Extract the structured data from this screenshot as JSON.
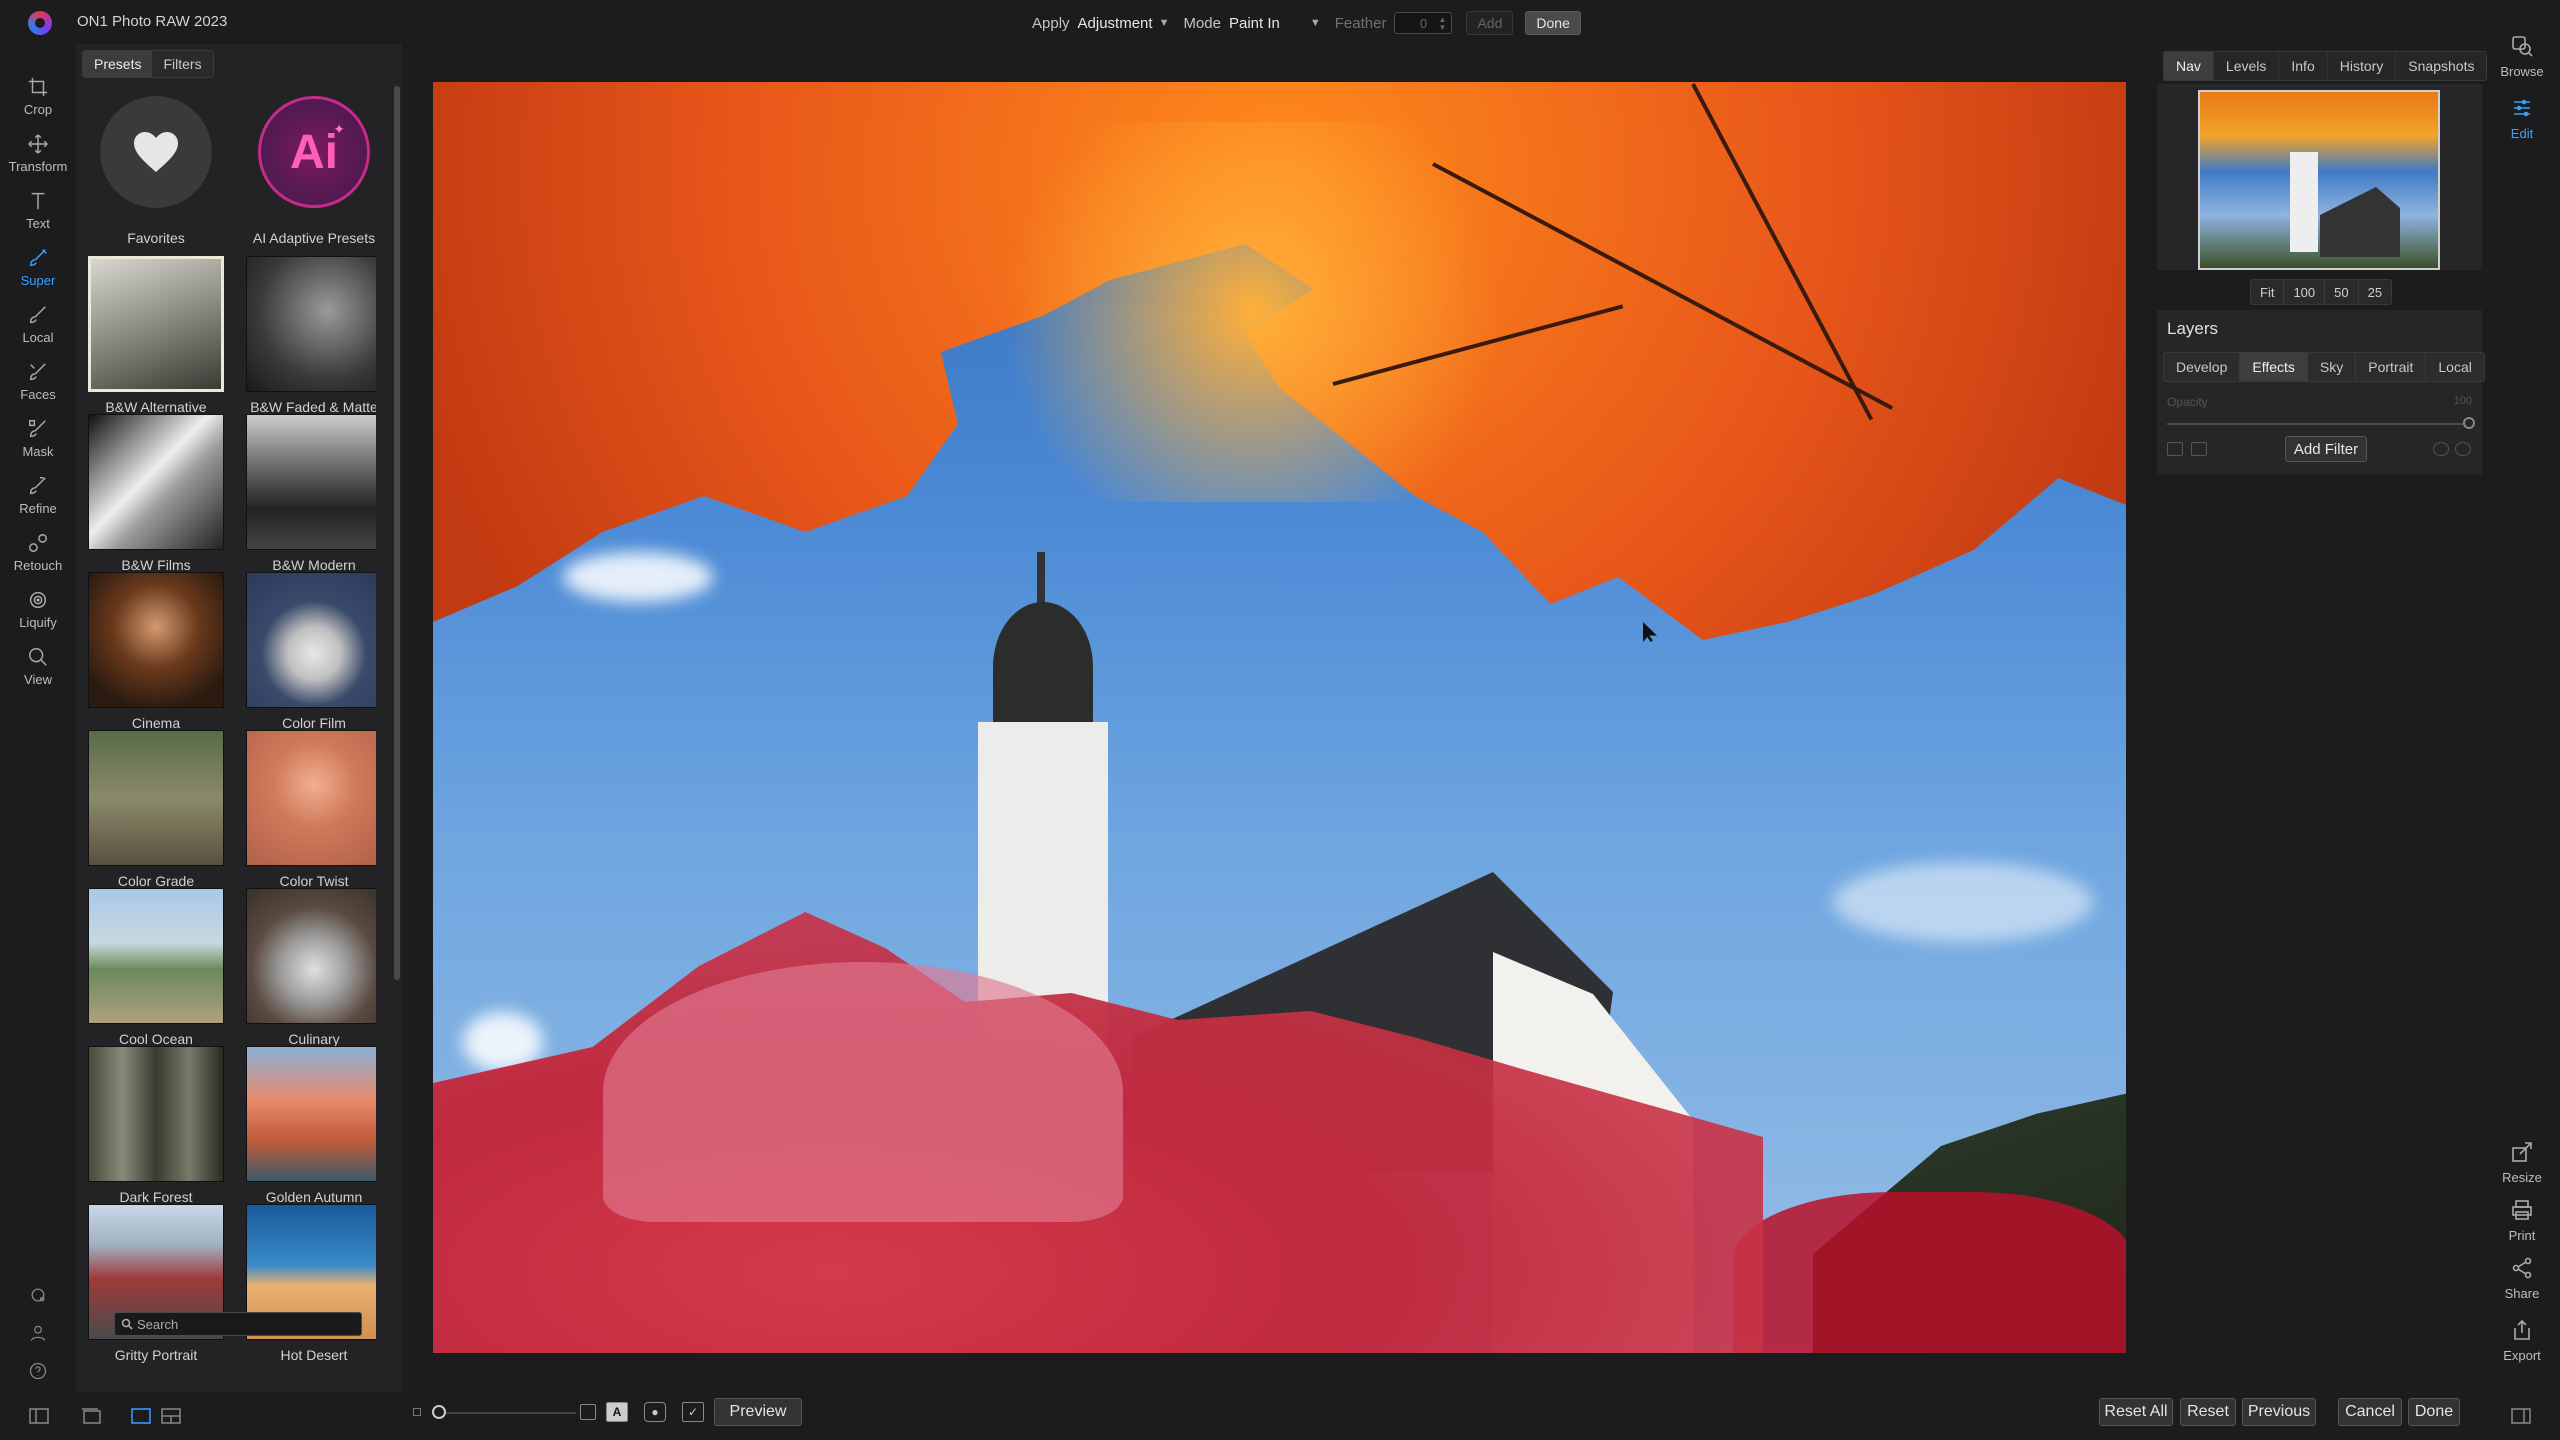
{
  "app": {
    "title": "ON1 Photo RAW 2023"
  },
  "topbar": {
    "apply_label": "Apply",
    "apply_value": "Adjustment",
    "mode_label": "Mode",
    "mode_value": "Paint In",
    "feather_label": "Feather",
    "feather_value": "0",
    "add_label": "Add",
    "done_label": "Done"
  },
  "tools": [
    {
      "label": "Crop",
      "icon": "crop-icon"
    },
    {
      "label": "Transform",
      "icon": "transform-icon"
    },
    {
      "label": "Text",
      "icon": "text-icon"
    },
    {
      "label": "Super",
      "icon": "super-brush-icon",
      "active": true
    },
    {
      "label": "Local",
      "icon": "local-brush-icon"
    },
    {
      "label": "Faces",
      "icon": "faces-icon"
    },
    {
      "label": "Mask",
      "icon": "mask-icon"
    },
    {
      "label": "Refine",
      "icon": "refine-icon"
    },
    {
      "label": "Retouch",
      "icon": "retouch-icon"
    },
    {
      "label": "Liquify",
      "icon": "liquify-icon"
    },
    {
      "label": "View",
      "icon": "view-icon"
    }
  ],
  "left_panel": {
    "tabs": [
      "Presets",
      "Filters"
    ],
    "active_tab": "Presets",
    "presets": [
      "Favorites",
      "AI Adaptive Presets",
      "B&W Alternative",
      "B&W Faded & Matte",
      "B&W Films",
      "B&W Modern",
      "Cinema",
      "Color Film",
      "Color Grade",
      "Color Twist",
      "Cool Ocean",
      "Culinary",
      "Dark Forest",
      "Golden Autumn",
      "Gritty Portrait",
      "Hot Desert"
    ],
    "selected_preset": "B&W Alternative",
    "ai_badge_text": "Ai",
    "search_placeholder": "Search"
  },
  "right_panel": {
    "nav_tabs": [
      "Nav",
      "Levels",
      "Info",
      "History",
      "Snapshots"
    ],
    "active_nav_tab": "Nav",
    "zoom_options": [
      "Fit",
      "100",
      "50",
      "25"
    ],
    "layers_title": "Layers",
    "filter_tabs": [
      "Develop",
      "Effects",
      "Sky",
      "Portrait",
      "Local"
    ],
    "active_filter_tab": "Effects",
    "opacity_label": "Opacity",
    "opacity_value": "100",
    "add_filter_label": "Add Filter"
  },
  "right_tools": {
    "top": [
      {
        "label": "Browse",
        "icon": "browse-icon"
      },
      {
        "label": "Edit",
        "icon": "edit-sliders-icon",
        "active": true
      }
    ],
    "bottom": [
      {
        "label": "Resize",
        "icon": "resize-icon"
      },
      {
        "label": "Print",
        "icon": "print-icon"
      },
      {
        "label": "Share",
        "icon": "share-icon"
      },
      {
        "label": "Export",
        "icon": "export-icon"
      }
    ]
  },
  "bottombar": {
    "preview_label": "Preview",
    "reset_all_label": "Reset All",
    "reset_label": "Reset",
    "previous_label": "Previous",
    "cancel_label": "Cancel",
    "done_label": "Done"
  }
}
